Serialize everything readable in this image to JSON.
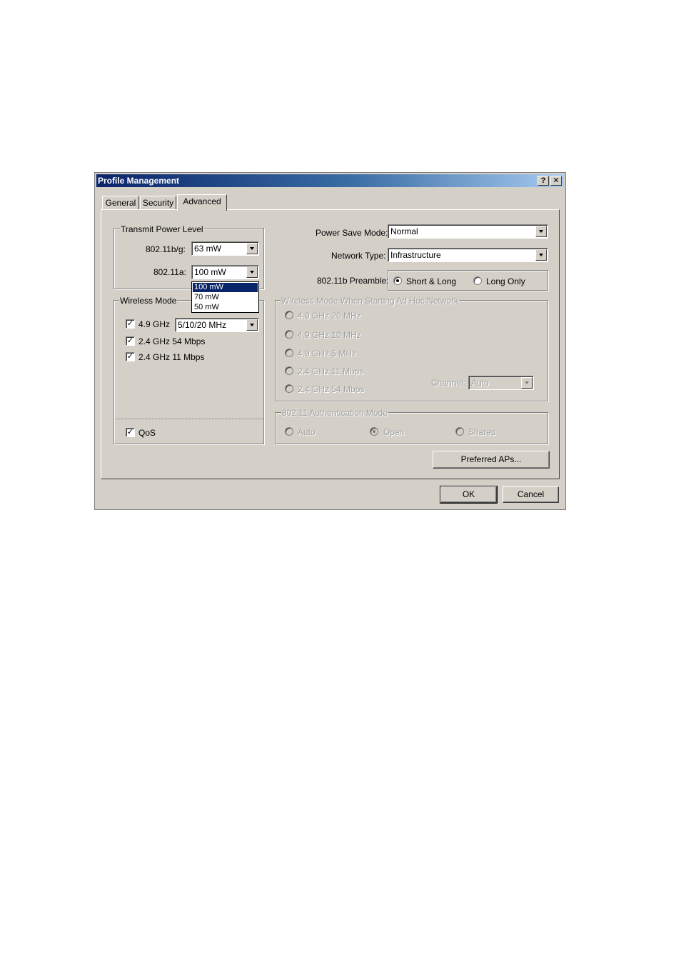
{
  "window": {
    "title": "Profile Management",
    "help_label": "?",
    "close_label": "✕"
  },
  "tabs": [
    {
      "label": "General"
    },
    {
      "label": "Security"
    },
    {
      "label": "Advanced",
      "active": true
    }
  ],
  "transmit_power": {
    "group_label": "Transmit Power Level",
    "bg_label": "802.11b/g:",
    "bg_value": "63 mW",
    "a_label": "802.11a:",
    "a_value": "100 mW",
    "a_options": [
      "100 mW",
      "70 mW",
      "50 mW"
    ],
    "a_selected_option": "100 mW"
  },
  "wireless_mode": {
    "group_label": "Wireless Mode",
    "items": [
      {
        "label": "4.9 GHz",
        "checked": true
      },
      {
        "label": "2.4 GHz 54 Mbps",
        "checked": true
      },
      {
        "label": "2.4 GHz 11 Mbps",
        "checked": true
      }
    ],
    "ghz49_value": "5/10/20 MHz",
    "qos_label": "QoS",
    "qos_checked": true
  },
  "power_save": {
    "label": "Power Save Mode:",
    "value": "Normal"
  },
  "network_type": {
    "label": "Network Type:",
    "value": "Infrastructure"
  },
  "preamble": {
    "label": "802.11b Preamble:",
    "options": [
      {
        "label": "Short & Long",
        "selected": true
      },
      {
        "label": "Long Only",
        "selected": false
      }
    ]
  },
  "adhoc": {
    "group_label": "Wireless Mode When Starting Ad Hoc Network",
    "options": [
      "4.9 GHz 20 MHz",
      "4.9 GHz 10 MHz",
      "4.9 GHz 5 MHz",
      "2.4 GHz 11 Mbps",
      "2.4 GHz 54 Mbps"
    ],
    "channel_label": "Channel:",
    "channel_value": "Auto"
  },
  "auth": {
    "group_label": "802.11 Authentication Mode",
    "options": [
      {
        "label": "Auto",
        "selected": false
      },
      {
        "label": "Open",
        "selected": true
      },
      {
        "label": "Shared",
        "selected": false
      }
    ]
  },
  "buttons": {
    "preferred_aps": "Preferred APs...",
    "ok": "OK",
    "cancel": "Cancel"
  }
}
